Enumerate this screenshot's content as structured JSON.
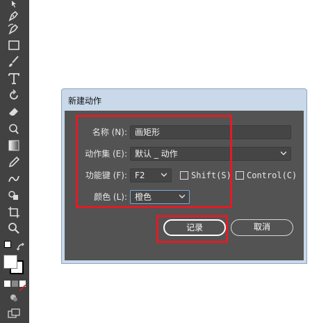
{
  "dialog": {
    "title": "新建动作",
    "name_label": "名称 (N):",
    "name_value": "画矩形",
    "set_label": "动作集 (E):",
    "set_value": "默认 _ 动作",
    "fkey_label": "功能键 (F):",
    "fkey_value": "F2",
    "shift_label": "Shift(S)",
    "control_label": "Control(C)",
    "color_label": "颜色 (L):",
    "color_value": "橙色",
    "record_button": "记录",
    "cancel_button": "取消"
  },
  "colors": {
    "highlight": "#e11c24",
    "dialog_bg": "#535353",
    "toolbar_bg": "#424242",
    "titlebar_bg": "#c9d9ea"
  },
  "toolbar": {
    "tools": [
      "direct-selection-icon",
      "pen-icon",
      "curvature-icon",
      "rectangle-icon",
      "paintbrush-icon",
      "type-icon",
      "rotate-icon",
      "eraser-icon",
      "warp-icon",
      "gradient-icon",
      "eyedropper-icon",
      "blend-icon",
      "shape-builder-icon",
      "artboard-icon",
      "zoom-icon"
    ]
  }
}
